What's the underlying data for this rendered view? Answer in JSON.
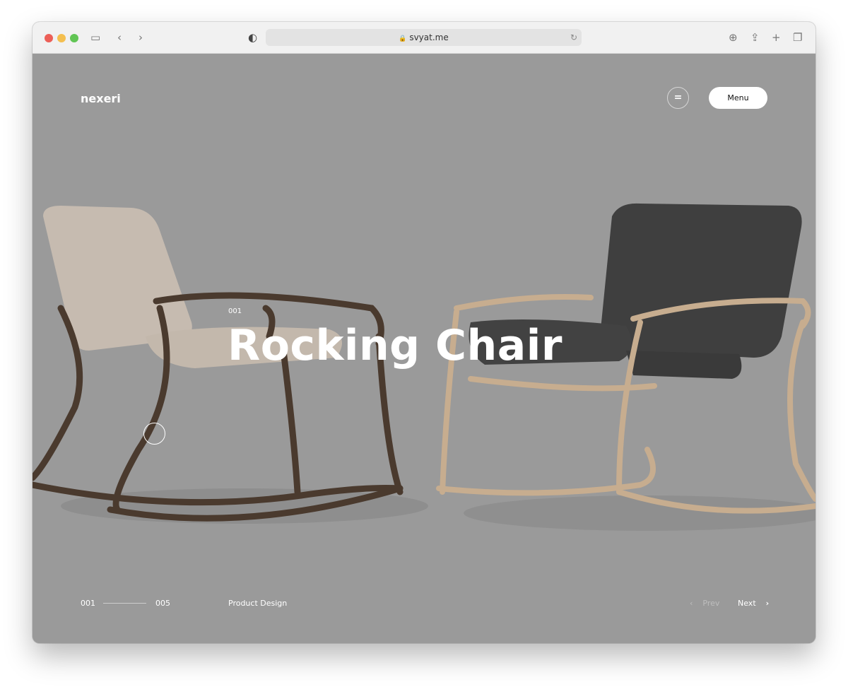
{
  "browser": {
    "url": "svyat.me",
    "traffic_lights": [
      "#ec5f57",
      "#f4bf4f",
      "#61c554"
    ]
  },
  "header": {
    "logo": "nexeri",
    "menu_label": "Menu",
    "menu_icon": "equals-icon"
  },
  "slide": {
    "number": "001",
    "title": "Rocking Chair",
    "category": "Product Design"
  },
  "pagination": {
    "current": "001",
    "total": "005",
    "prev_label": "Prev",
    "next_label": "Next"
  },
  "colors": {
    "background": "#9a9a9a"
  }
}
